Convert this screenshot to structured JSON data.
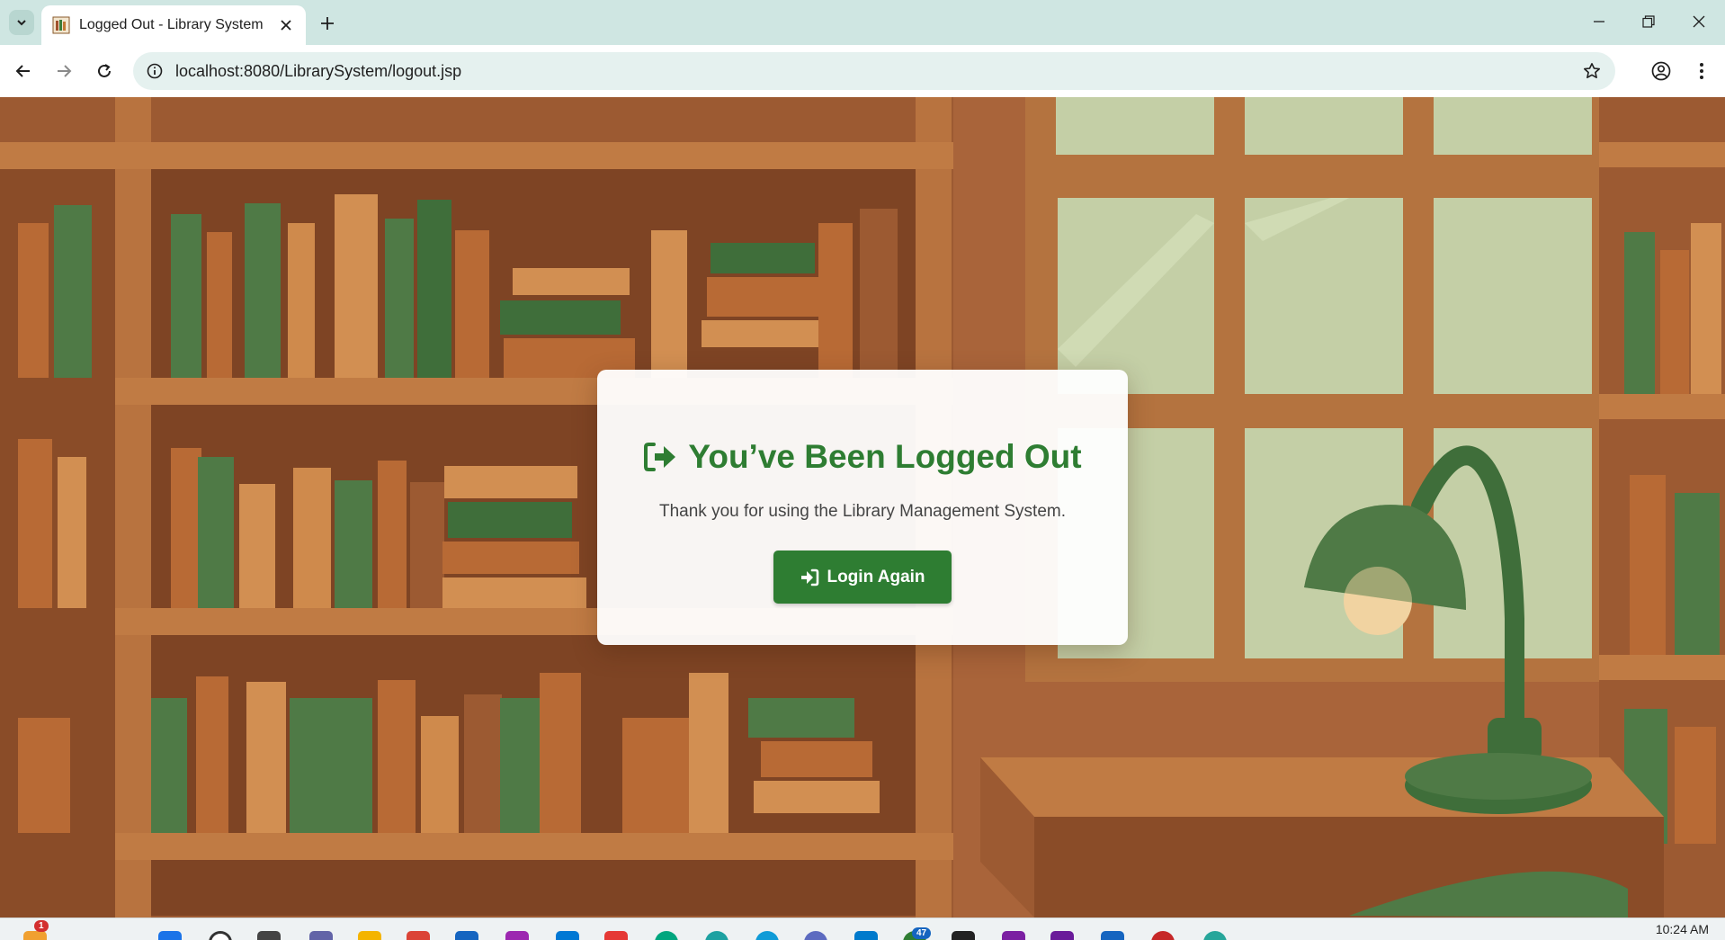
{
  "browser": {
    "tab_title": "Logged Out - Library System",
    "url": "localhost:8080/LibrarySystem/logout.jsp"
  },
  "page": {
    "heading": "You’ve Been Logged Out",
    "message": "Thank you for using the Library Management System.",
    "login_button": "Login Again",
    "accent_color": "#2e7d32"
  },
  "taskbar": {
    "notification_count": "1",
    "mail_badge": "47",
    "time": "10:24 AM"
  }
}
